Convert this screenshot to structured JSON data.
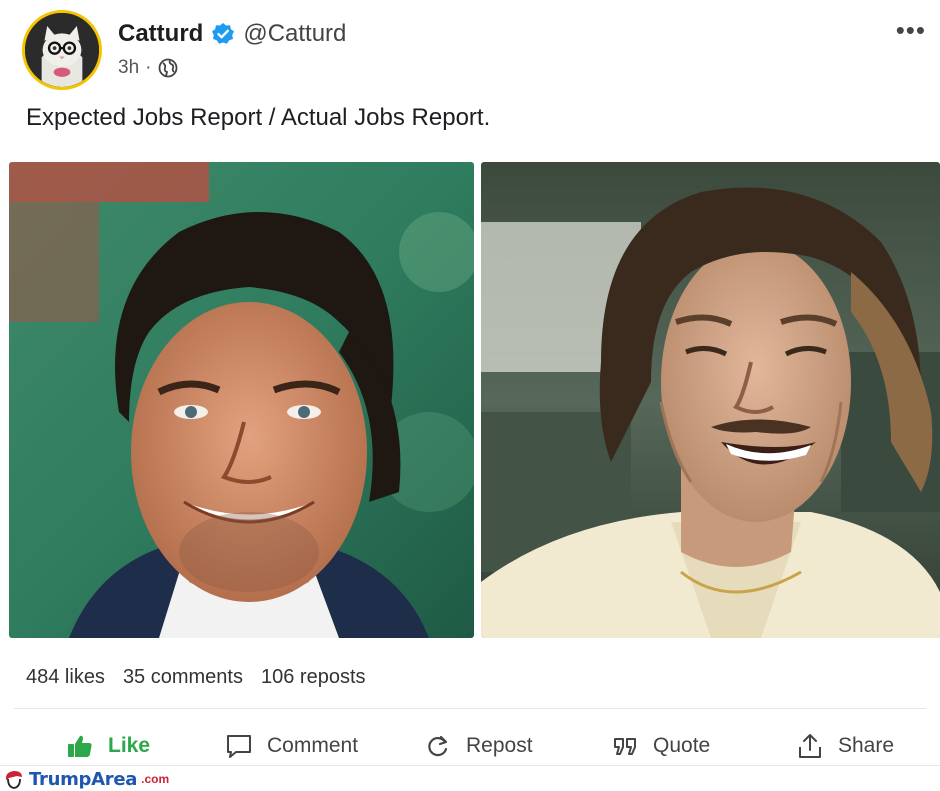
{
  "post": {
    "author": {
      "name": "Catturd",
      "handle": "@Catturd",
      "verified": true,
      "avatar_icon": "cat-with-glasses-avatar"
    },
    "time": "3h",
    "separator": "·",
    "visibility_icon": "globe-icon",
    "more_label": "•••",
    "text": "Expected Jobs Report / Actual Jobs Report.",
    "images": [
      {
        "subject": "smiling-man-portrait"
      },
      {
        "subject": "laughing-man-in-car"
      }
    ]
  },
  "stats": {
    "likes": "484 likes",
    "comments": "35 comments",
    "reposts": "106 reposts"
  },
  "actions": {
    "like": "Like",
    "comment": "Comment",
    "repost": "Repost",
    "quote": "Quote",
    "share": "Share"
  },
  "colors": {
    "like_active": "#2aa84a",
    "verified": "#1d9bf0",
    "avatar_ring": "#f5c400",
    "watermark_blue": "#1f57b0",
    "watermark_red": "#cc2233"
  },
  "watermark": {
    "brand": "TrumpArea",
    "suffix": ".com"
  }
}
